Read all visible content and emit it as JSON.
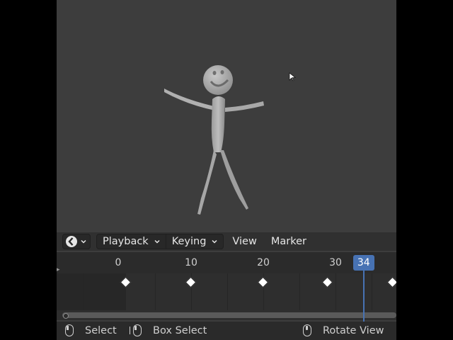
{
  "viewport": {
    "background_color": "#3d3d3d",
    "object": "stick-figure-character"
  },
  "timeline_header": {
    "editor_type_icon": "clock-icon",
    "menus": [
      {
        "label": "Playback",
        "has_dropdown": true
      },
      {
        "label": "Keying",
        "has_dropdown": true
      },
      {
        "label": "View",
        "has_dropdown": false
      },
      {
        "label": "Marker",
        "has_dropdown": false
      }
    ]
  },
  "ruler": {
    "ticks": [
      "0",
      "10",
      "20",
      "30"
    ],
    "current_frame": "34"
  },
  "keyframes": [
    1,
    10,
    20,
    29,
    38
  ],
  "status_bar": {
    "select": "Select",
    "box_select": "Box Select",
    "rotate_view": "Rotate View"
  },
  "colors": {
    "accent": "#4772b3",
    "keyframe": "#ffffff"
  }
}
